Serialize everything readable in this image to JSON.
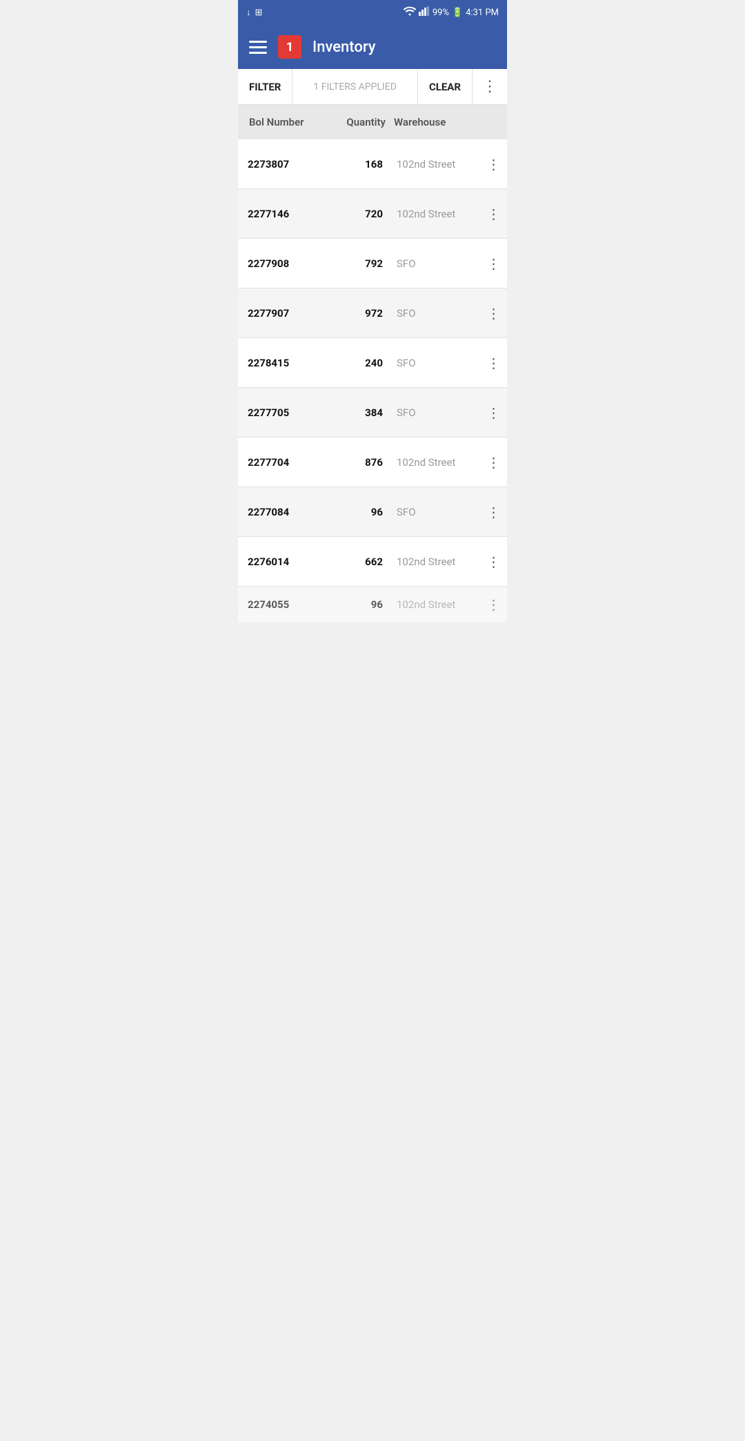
{
  "statusBar": {
    "time": "4:31 PM",
    "battery": "99%",
    "signal": "wifi+cellular"
  },
  "appBar": {
    "title": "Inventory",
    "notificationCount": "1"
  },
  "filterBar": {
    "filterLabel": "FILTER",
    "filtersApplied": "1 FILTERS APPLIED",
    "clearLabel": "CLEAR"
  },
  "tableHeaders": {
    "bolNumber": "Bol Number",
    "quantity": "Quantity",
    "warehouse": "Warehouse"
  },
  "rows": [
    {
      "bol": "2273807",
      "qty": "168",
      "warehouse": "102nd Street"
    },
    {
      "bol": "2277146",
      "qty": "720",
      "warehouse": "102nd Street"
    },
    {
      "bol": "2277908",
      "qty": "792",
      "warehouse": "SFO"
    },
    {
      "bol": "2277907",
      "qty": "972",
      "warehouse": "SFO"
    },
    {
      "bol": "2278415",
      "qty": "240",
      "warehouse": "SFO"
    },
    {
      "bol": "2277705",
      "qty": "384",
      "warehouse": "SFO"
    },
    {
      "bol": "2277704",
      "qty": "876",
      "warehouse": "102nd Street"
    },
    {
      "bol": "2277084",
      "qty": "96",
      "warehouse": "SFO"
    },
    {
      "bol": "2276014",
      "qty": "662",
      "warehouse": "102nd Street"
    },
    {
      "bol": "2274055",
      "qty": "96",
      "warehouse": "102nd Street"
    }
  ]
}
